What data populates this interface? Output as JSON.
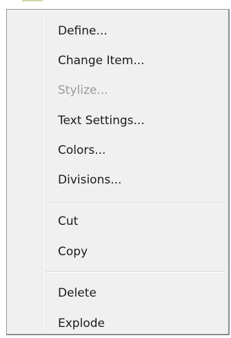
{
  "context_menu": {
    "groups": [
      {
        "items": [
          {
            "label": "Define...",
            "enabled": true
          },
          {
            "label": "Change Item...",
            "enabled": true
          },
          {
            "label": "Stylize...",
            "enabled": false
          },
          {
            "label": "Text Settings...",
            "enabled": true
          },
          {
            "label": "Colors...",
            "enabled": true
          },
          {
            "label": "Divisions...",
            "enabled": true
          }
        ]
      },
      {
        "items": [
          {
            "label": "Cut",
            "enabled": true
          },
          {
            "label": "Copy",
            "enabled": true
          }
        ]
      },
      {
        "items": [
          {
            "label": "Delete",
            "enabled": true
          },
          {
            "label": "Explode",
            "enabled": true
          }
        ]
      }
    ]
  }
}
